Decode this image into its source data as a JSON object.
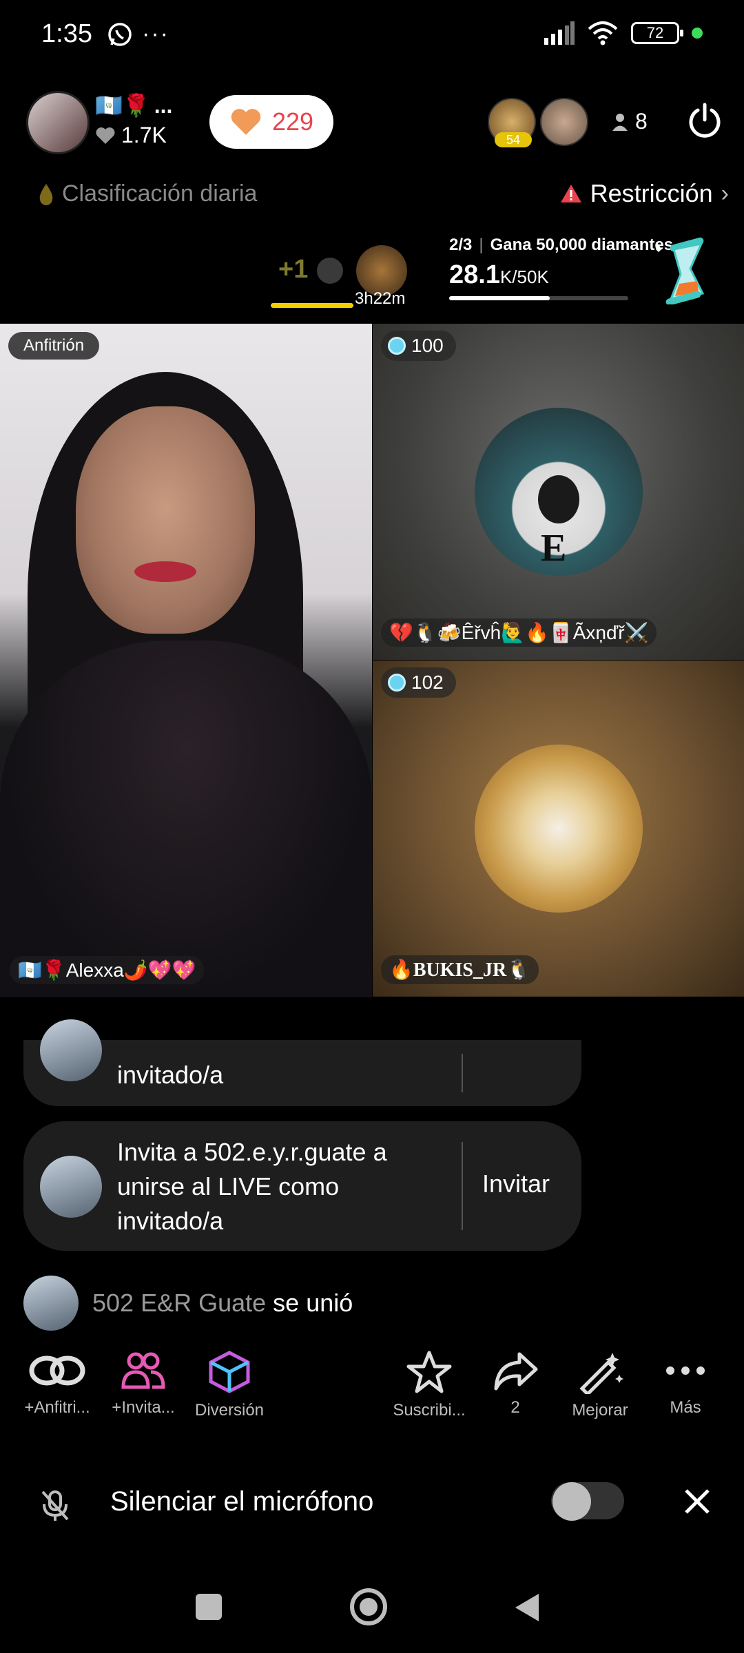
{
  "status_bar": {
    "time": "1:35",
    "battery": "72",
    "icons": [
      "whatsapp-icon",
      "more-dots-icon",
      "signal-icon",
      "wifi-icon",
      "battery-icon"
    ]
  },
  "header": {
    "host_likes": "1.7K",
    "host_flags": "🇬🇹🌹",
    "host_more": "...",
    "hearts": "229",
    "viewer_badge": "54",
    "viewer_count": "8"
  },
  "banner": {
    "daily_rank": "Clasificación diaria",
    "restriction": "Restricción",
    "plus_one": "+1",
    "timer": "3h22m",
    "goal_step": "2/3",
    "goal_text": "Gana  50,000 diamantes",
    "goal_value": "28.1",
    "goal_unit": "K/50K",
    "goal_progress": 0.562
  },
  "grid": {
    "host_label": "Anfitrión",
    "host_name": "🇬🇹🌹Alexxa🌶️💖💖",
    "guest1_score": "100",
    "guest1_name": "💔🐧🍻Êřvĥ🙋‍♂️🔥🀄Ãxņďř⚔️",
    "guest2_score": "102",
    "guest2_name": "🔥BUKIS_JR🐧"
  },
  "chat": {
    "card1_text": "invitado/a",
    "card2_text_line1": "Invita a 502.e.y.r.guate a",
    "card2_text_line2": "unirse al LIVE como",
    "card2_text_line3": "invitado/a",
    "invite_button": "Invitar",
    "joined_user": "502 E&R Guate",
    "joined_suffix": " se unió"
  },
  "toolbar": {
    "cohost": "+Anfitri...",
    "invite": "+Invita...",
    "fun": "Diversión",
    "subscribe": "Suscribi...",
    "share_count": "2",
    "enhance": "Mejorar",
    "more": "Más"
  },
  "mute": {
    "label": "Silenciar el micrófono",
    "enabled": false
  }
}
